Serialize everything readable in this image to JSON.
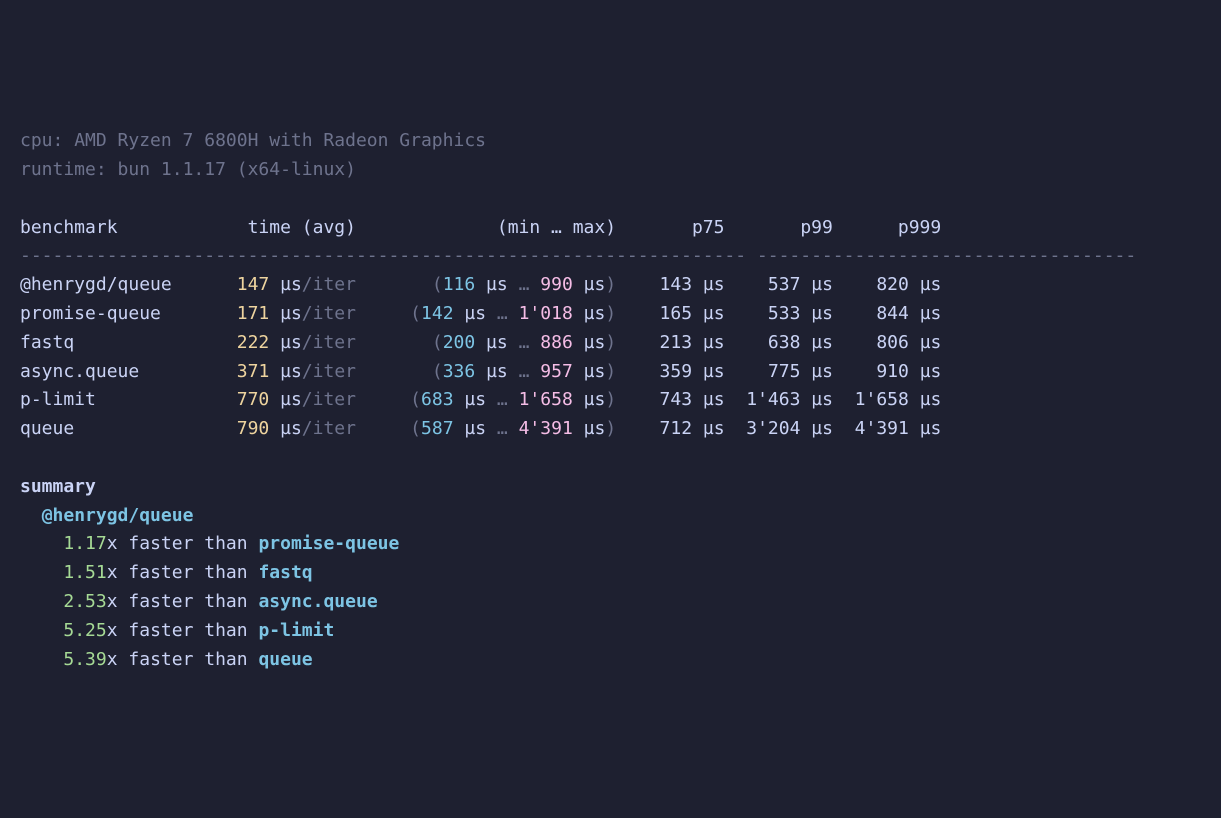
{
  "header": {
    "cpu_label": "cpu: ",
    "cpu_value": "AMD Ryzen 7 6800H with Radeon Graphics",
    "runtime_label": "runtime: ",
    "runtime_value": "bun 1.1.17 (x64-linux)"
  },
  "columns": {
    "benchmark": "benchmark",
    "time": "time (avg)",
    "minmax": "(min … max)",
    "p75": "p75",
    "p99": "p99",
    "p999": "p999"
  },
  "rows": [
    {
      "name": "@henrygd/queue",
      "avg": "147",
      "unit": "µs",
      "iter": "/iter",
      "min": "116",
      "max": "990",
      "p75": "143",
      "p99": "537",
      "p999": "820"
    },
    {
      "name": "promise-queue",
      "avg": "171",
      "unit": "µs",
      "iter": "/iter",
      "min": "142",
      "max": "1'018",
      "p75": "165",
      "p99": "533",
      "p999": "844"
    },
    {
      "name": "fastq",
      "avg": "222",
      "unit": "µs",
      "iter": "/iter",
      "min": "200",
      "max": "886",
      "p75": "213",
      "p99": "638",
      "p999": "806"
    },
    {
      "name": "async.queue",
      "avg": "371",
      "unit": "µs",
      "iter": "/iter",
      "min": "336",
      "max": "957",
      "p75": "359",
      "p99": "775",
      "p999": "910"
    },
    {
      "name": "p-limit",
      "avg": "770",
      "unit": "µs",
      "iter": "/iter",
      "min": "683",
      "max": "1'658",
      "p75": "743",
      "p99": "1'463",
      "p999": "1'658"
    },
    {
      "name": "queue",
      "avg": "790",
      "unit": "µs",
      "iter": "/iter",
      "min": "587",
      "max": "4'391",
      "p75": "712",
      "p99": "3'204",
      "p999": "4'391"
    }
  ],
  "summary": {
    "title": "summary",
    "winner": "@henrygd/queue",
    "faster_than": " faster than ",
    "x_suffix": "x",
    "comparisons": [
      {
        "factor": "1.17",
        "name": "promise-queue"
      },
      {
        "factor": "1.51",
        "name": "fastq"
      },
      {
        "factor": "2.53",
        "name": "async.queue"
      },
      {
        "factor": "5.25",
        "name": "p-limit"
      },
      {
        "factor": "5.39",
        "name": "queue"
      }
    ]
  },
  "glyphs": {
    "ellipsis": "…",
    "lparen": "(",
    "rparen": ")",
    "space": " "
  },
  "chart_data": {
    "type": "table",
    "title": "benchmark",
    "columns": [
      "benchmark",
      "time (avg) µs/iter",
      "min µs",
      "max µs",
      "p75 µs",
      "p99 µs",
      "p999 µs"
    ],
    "rows": [
      [
        "@henrygd/queue",
        147,
        116,
        990,
        143,
        537,
        820
      ],
      [
        "promise-queue",
        171,
        142,
        1018,
        165,
        533,
        844
      ],
      [
        "fastq",
        222,
        200,
        886,
        213,
        638,
        806
      ],
      [
        "async.queue",
        371,
        336,
        957,
        359,
        775,
        910
      ],
      [
        "p-limit",
        770,
        683,
        1658,
        743,
        1463,
        1658
      ],
      [
        "queue",
        790,
        587,
        4391,
        712,
        3204,
        4391
      ]
    ],
    "summary_factors": {
      "baseline": "@henrygd/queue",
      "promise-queue": 1.17,
      "fastq": 1.51,
      "async.queue": 2.53,
      "p-limit": 5.25,
      "queue": 5.39
    }
  }
}
